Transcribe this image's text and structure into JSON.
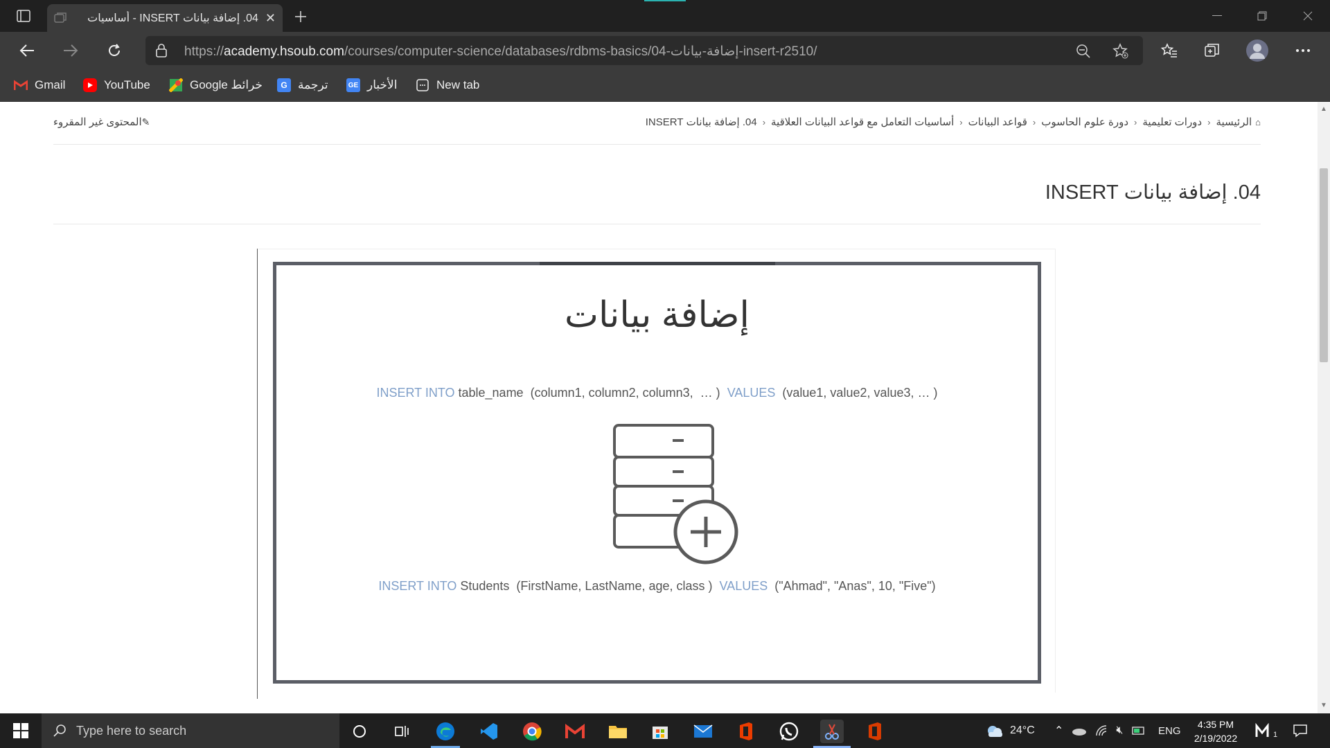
{
  "browser": {
    "tab_title": "04. إضافة بيانات INSERT - أساسيات",
    "url_prefix": "https://",
    "url_host": "academy.hsoub.com",
    "url_path": "/courses/computer-science/databases/rdbms-basics/04-إضافة-بيانات-insert-r2510/",
    "bookmarks": [
      {
        "label": "Gmail",
        "icon": "gmail-icon"
      },
      {
        "label": "YouTube",
        "icon": "youtube-icon"
      },
      {
        "label": "Google خرائط",
        "icon": "google-maps-icon"
      },
      {
        "label": "ترجمة",
        "icon": "translate-icon"
      },
      {
        "label": "الأخبار",
        "icon": "news-icon"
      },
      {
        "label": "New tab",
        "icon": "new-tab-icon"
      }
    ]
  },
  "page": {
    "breadcrumb": [
      "الرئيسية",
      "دورات تعليمية",
      "دورة علوم الحاسوب",
      "قواعد البيانات",
      "أساسيات التعامل مع قواعد البيانات العلاقية",
      "04. إضافة بيانات INSERT"
    ],
    "unread_label": "المحتوى غير المقروء",
    "title": "04. إضافة بيانات INSERT"
  },
  "slide": {
    "title": "إضافة بيانات",
    "syntax": {
      "keyword1": "INSERT INTO",
      "part1": " table_name  (column1, column2, column3,  … )  ",
      "keyword2": "VALUES",
      "part2": "  (value1, value2, value3, … )"
    },
    "example": {
      "keyword1": "INSERT INTO",
      "part1": " Students  (FirstName, LastName, age, class )  ",
      "keyword2": "VALUES",
      "part2": "  (\"Ahmad\", \"Anas\", 10, \"Five\")"
    }
  },
  "taskbar": {
    "search_placeholder": "Type here to search",
    "weather": "24°C",
    "language": "ENG",
    "time": "4:35 PM",
    "date": "2/19/2022",
    "notification_count": "1"
  }
}
